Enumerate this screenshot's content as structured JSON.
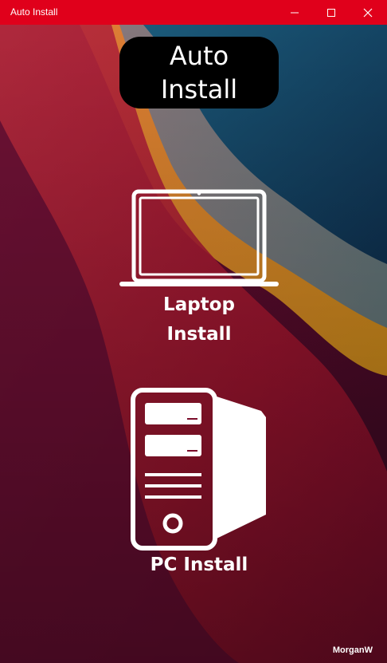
{
  "window": {
    "title": "Auto Install",
    "controls": [
      "minimize",
      "maximize",
      "close"
    ]
  },
  "heading": {
    "line1": "Auto",
    "line2": "Install"
  },
  "options": [
    {
      "icon": "laptop-icon",
      "line1": "Laptop",
      "line2": "Install"
    },
    {
      "icon": "desktop-tower-icon",
      "line1": "PC Install"
    }
  ],
  "footer": {
    "author": "MorganW"
  },
  "colors": {
    "titlebar": "#e0001b",
    "pill": "#000000",
    "text": "#ffffff"
  }
}
